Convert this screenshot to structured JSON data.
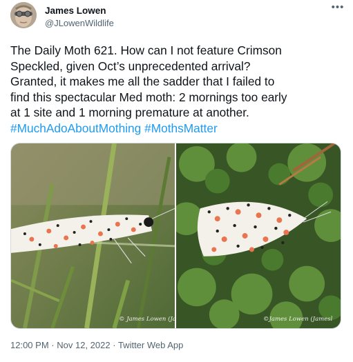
{
  "author": {
    "name": "James Lowen",
    "handle": "@JLowenWildlife",
    "avatar_icon": "user-avatar"
  },
  "more_icon": "ellipsis-icon",
  "tweet": {
    "lines": [
      "The Daily Moth 621. How can I not feature Crimson",
      "Speckled, given Oct’s unprecedented arrival?",
      "Granted, it makes me all the sadder that I failed to",
      "find this spectacular Med moth: 2 mornings too early",
      "at 1 site and 1 morning premature at another."
    ],
    "hashtags": [
      "#MuchAdoAboutMothing",
      "#MothsMatter"
    ]
  },
  "media": {
    "watermark_left": "© James Lowen (Jam",
    "watermark_right": "©James Lowen (Jamesl"
  },
  "timestamp": {
    "time": "12:00 PM",
    "separator": "·",
    "date": "Nov 12, 2022",
    "source": "Twitter Web App"
  },
  "colors": {
    "hashtag": "#1d9bf0",
    "text": "#0f1419",
    "secondary": "#536471"
  }
}
